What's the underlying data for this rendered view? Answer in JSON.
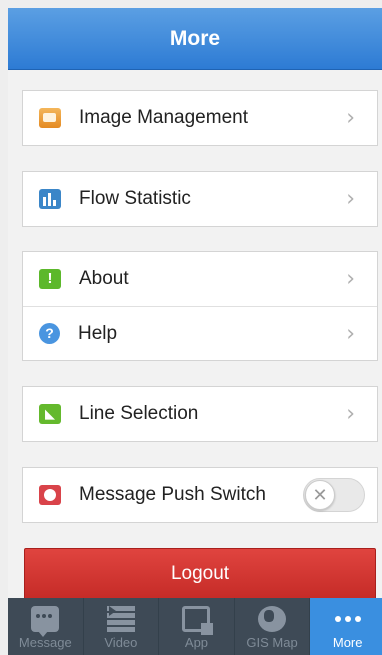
{
  "header": {
    "title": "More"
  },
  "menu": {
    "image_management": "Image Management",
    "flow_statistic": "Flow Statistic",
    "about": "About",
    "help": "Help",
    "line_selection": "Line Selection",
    "message_push_switch": "Message Push Switch",
    "chevron": "›",
    "push_switch_on": false
  },
  "logout_label": "Logout",
  "tabbar": {
    "tabs": [
      {
        "label": "Message",
        "icon": "message-icon"
      },
      {
        "label": "Video",
        "icon": "video-icon"
      },
      {
        "label": "App",
        "icon": "app-icon"
      },
      {
        "label": "GIS Map",
        "icon": "globe-icon"
      },
      {
        "label": "More",
        "icon": "more-icon",
        "active": true
      }
    ]
  },
  "colors": {
    "header": "#3d8ad9",
    "logout": "#d23632",
    "tabbar": "#3e4a56",
    "tab_active": "#3a8fe0"
  }
}
